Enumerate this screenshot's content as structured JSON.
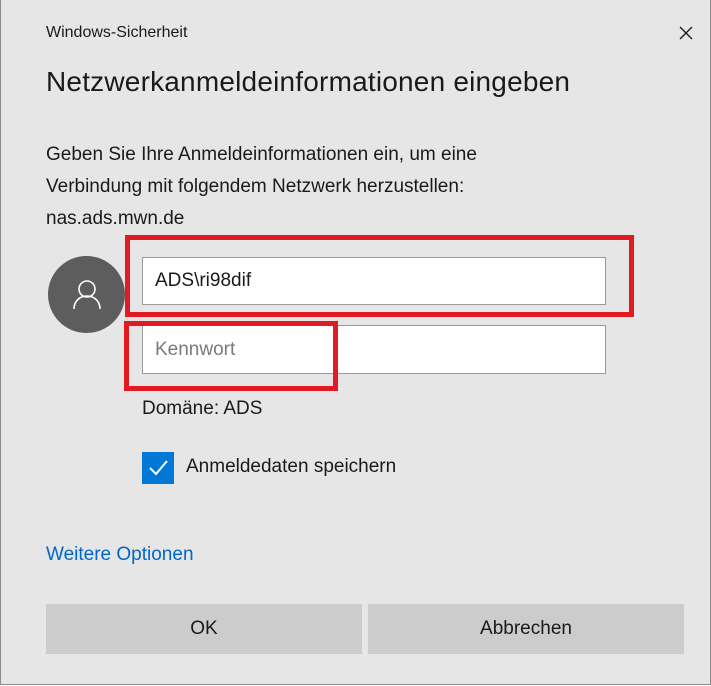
{
  "window": {
    "title": "Windows-Sicherheit",
    "close_icon": "close-icon"
  },
  "heading": "Netzwerkanmeldeinformationen eingeben",
  "description": {
    "line1": "Geben Sie Ihre Anmeldeinformationen ein, um eine",
    "line2": "Verbindung mit folgendem Netzwerk herzustellen:",
    "line3": "nas.ads.mwn.de"
  },
  "avatar_icon": "user-icon",
  "username": {
    "value": "ADS\\ri98dif"
  },
  "password": {
    "value": "",
    "placeholder": "Kennwort"
  },
  "domain_text": "Domäne: ADS",
  "remember": {
    "label": "Anmeldedaten speichern",
    "checked": true
  },
  "more_options": "Weitere Optionen",
  "buttons": {
    "ok": "OK",
    "cancel": "Abbrechen"
  },
  "colors": {
    "accent": "#0078d7",
    "link": "#0066cc",
    "highlight": "#e21a22",
    "dialog_bg": "#e6e6e6"
  }
}
